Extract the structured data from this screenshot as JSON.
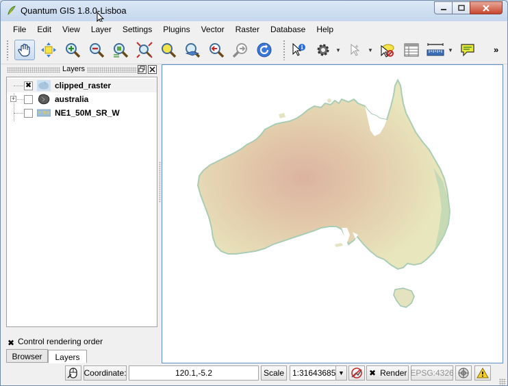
{
  "window": {
    "title": "Quantum GIS 1.8.0-Lisboa"
  },
  "menu": [
    "File",
    "Edit",
    "View",
    "Layer",
    "Settings",
    "Plugins",
    "Vector",
    "Raster",
    "Database",
    "Help"
  ],
  "toolbar": {
    "overflow": "»",
    "tools": [
      "pan-map",
      "pan-to-selection",
      "zoom-in",
      "zoom-out",
      "zoom-to-native-resolution",
      "zoom-full",
      "zoom-to-selection",
      "zoom-to-layer",
      "zoom-last",
      "zoom-next",
      "refresh",
      "identify",
      "action",
      "select",
      "deselect",
      "open-attribute-table",
      "measure",
      "map-tips"
    ]
  },
  "layers_panel": {
    "title": "Layers",
    "layers": [
      {
        "name": "clipped_raster",
        "checked": "✖",
        "icon": "raster-layer-icon"
      },
      {
        "name": "australia",
        "checked": "",
        "icon": "vector-polygon-layer-icon"
      },
      {
        "name": "NE1_50M_SR_W",
        "checked": "",
        "icon": "raster-layer-icon"
      }
    ],
    "control_rendering_order": {
      "label": "Control rendering order",
      "checked": "✖"
    },
    "tabs": [
      "Browser",
      "Layers"
    ]
  },
  "statusbar": {
    "coordinate_label": "Coordinate:",
    "coordinate_value": "120.1,-5.2",
    "scale_label": "Scale",
    "scale_value": "1:31643685",
    "render_label": "Render",
    "render_checked": "✖",
    "crs": "EPSG:4326"
  },
  "colors": {
    "canvas_border": "#5b8fd0",
    "map_land_light": "#e9e6bf",
    "map_land_desert": "#dfb9a2",
    "map_coast": "#9fc7b0"
  }
}
